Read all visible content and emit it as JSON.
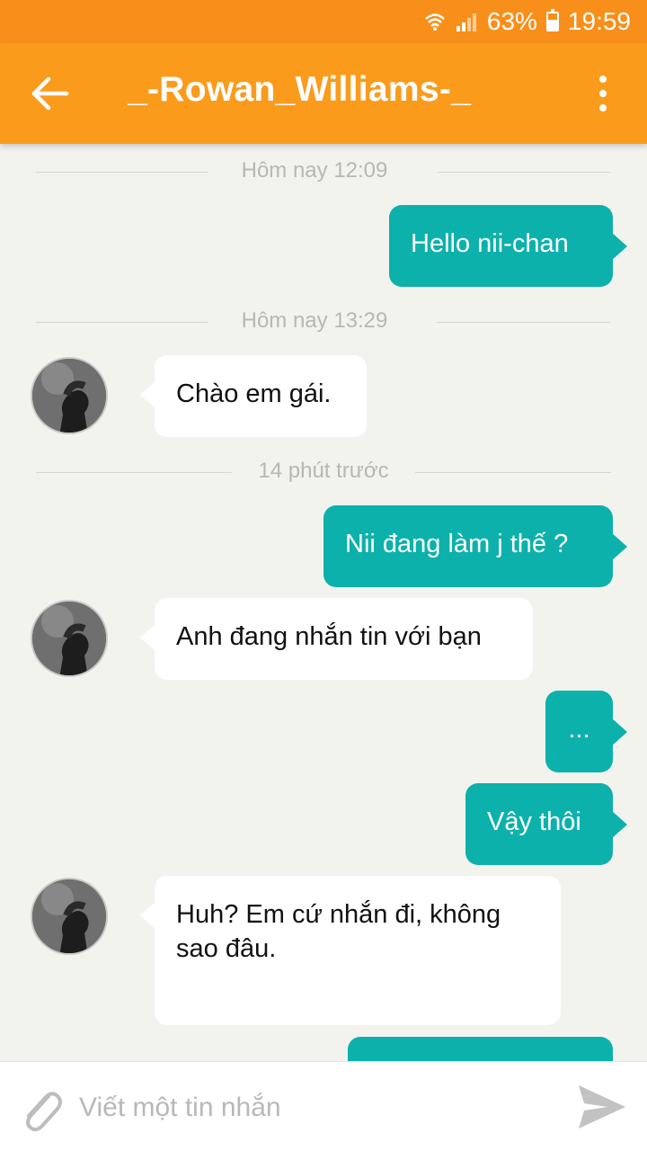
{
  "status_bar": {
    "battery": "63%",
    "time": "19:59",
    "battery_level": 0.63
  },
  "header": {
    "title": "_-Rowan_Williams-_",
    "color": "#fb9b1c"
  },
  "dividers": [
    "Hôm nay 12:09",
    "Hôm nay 13:29",
    "14 phút trước"
  ],
  "messages": [
    {
      "direction": "out",
      "text": "Hello nii-chan"
    },
    {
      "direction": "in",
      "text": "Chào em gái."
    },
    {
      "direction": "out",
      "text": "Nii đang làm j thế ?"
    },
    {
      "direction": "in",
      "text": "Anh đang nhắn tin với bạn"
    },
    {
      "direction": "out",
      "text": "..."
    },
    {
      "direction": "out",
      "text": "Vậy thôi"
    },
    {
      "direction": "in",
      "text": "Huh? Em cứ nhắn đi, không sao đâu."
    }
  ],
  "composer": {
    "placeholder": "Viết một tin nhắn"
  },
  "colors": {
    "outgoing_bubble": "#0db1ab",
    "incoming_bubble": "#ffffff",
    "status_bar": "#f88f1a",
    "background": "#f3f3ee"
  },
  "icons": {
    "back": "arrow-left-icon",
    "menu": "more-vert-icon",
    "attach": "paperclip-icon",
    "send": "send-icon",
    "wifi": "wifi-icon",
    "signal": "signal-icon",
    "battery": "battery-icon"
  }
}
